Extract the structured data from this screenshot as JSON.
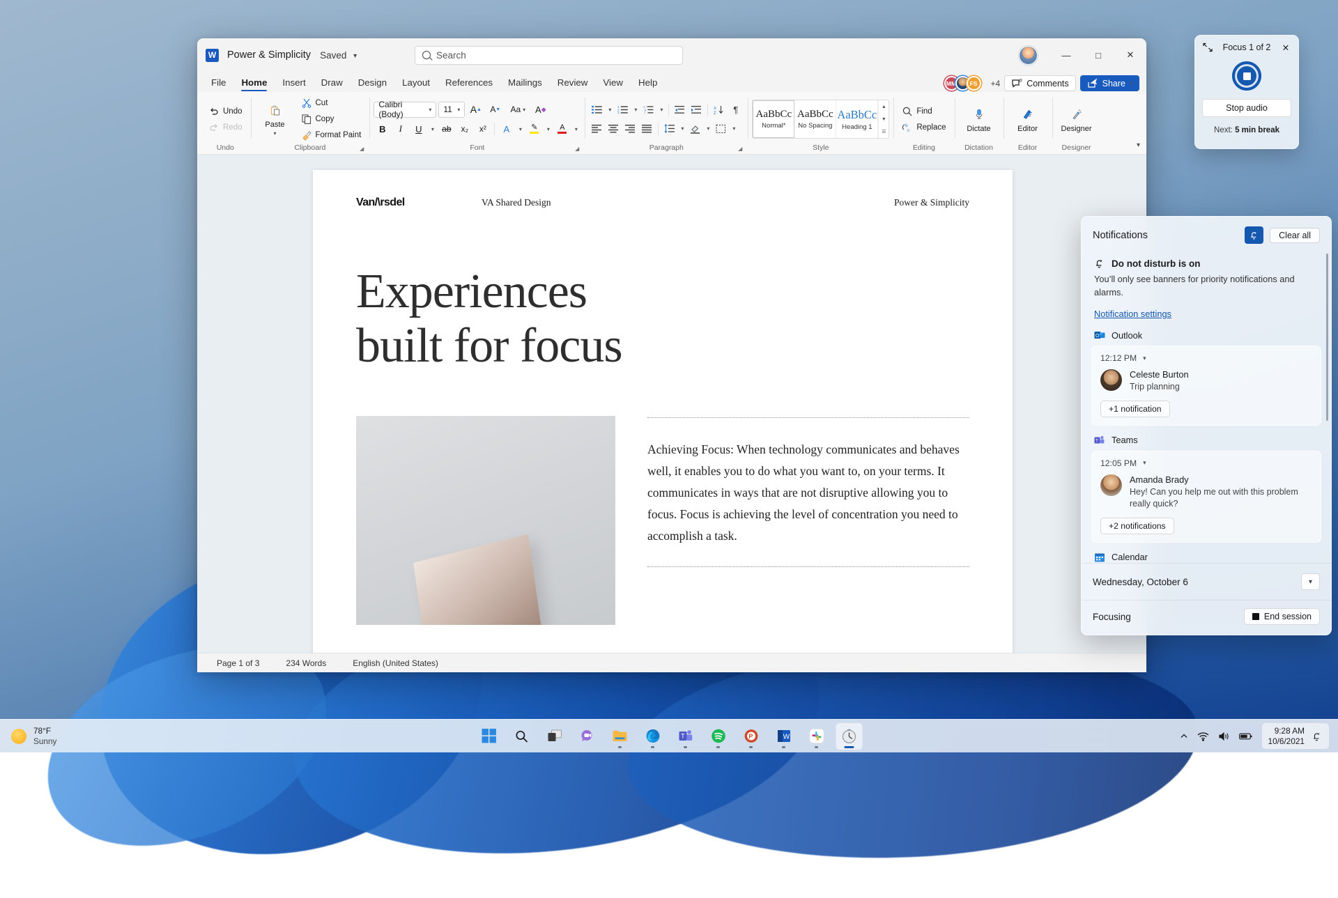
{
  "word": {
    "title": "Power & Simplicity",
    "saved_status": "Saved",
    "search_placeholder": "Search",
    "tabs": [
      {
        "label": "File",
        "active": false
      },
      {
        "label": "Home",
        "active": true
      },
      {
        "label": "Insert",
        "active": false
      },
      {
        "label": "Draw",
        "active": false
      },
      {
        "label": "Design",
        "active": false
      },
      {
        "label": "Layout",
        "active": false
      },
      {
        "label": "References",
        "active": false
      },
      {
        "label": "Mailings",
        "active": false
      },
      {
        "label": "Review",
        "active": false
      },
      {
        "label": "View",
        "active": false
      },
      {
        "label": "Help",
        "active": false
      }
    ],
    "collab": {
      "faces": [
        "MM",
        "",
        "FS"
      ],
      "more": "+4",
      "comments_label": "Comments",
      "share_label": "Share"
    },
    "window_controls": {
      "minimize": "—",
      "maximize": "□",
      "close": "✕"
    },
    "ribbon": {
      "undo": {
        "group_label": "Undo",
        "undo_label": "Undo",
        "redo_label": "Redo"
      },
      "clipboard": {
        "group_label": "Clipboard",
        "paste_label": "Paste",
        "cut_label": "Cut",
        "copy_label": "Copy",
        "format_painter_label": "Format Paint"
      },
      "font": {
        "group_label": "Font",
        "font_name": "Calibri (Body)",
        "font_size": "11",
        "grow_label": "A",
        "shrink_label": "A",
        "change_case_label": "Aa",
        "clear_format_label": "A",
        "bold": "B",
        "italic": "I",
        "underline": "U",
        "strikethrough": "ab",
        "subscript": "x₂",
        "superscript": "x²",
        "text_effects": "A",
        "highlight": "A",
        "font_color": "A"
      },
      "paragraph": {
        "group_label": "Paragraph"
      },
      "style": {
        "group_label": "Style",
        "items": [
          {
            "preview": "AaBbCc",
            "name": "Normal*",
            "selected": true
          },
          {
            "preview": "AaBbCc",
            "name": "No Spacing",
            "selected": false
          },
          {
            "preview": "AaBbCc",
            "name": "Heading 1",
            "selected": false,
            "heading": true
          }
        ]
      },
      "editing": {
        "group_label": "Editing",
        "find_label": "Find",
        "replace_label": "Replace"
      },
      "dictation": {
        "group_label": "Dictation",
        "dictate_label": "Dictate"
      },
      "editor": {
        "group_label": "Editor",
        "editor_label": "Editor"
      },
      "designer": {
        "group_label": "Designer",
        "designer_label": "Designer"
      }
    },
    "document": {
      "brand": "Van/\\rsdel",
      "subtitle": "VA Shared Design",
      "right_label": "Power & Simplicity",
      "heading_line1": "Experiences",
      "heading_line2": "built for focus",
      "paragraph": "Achieving Focus: When technology communicates and behaves well, it enables you to do what you want to, on your terms. It communicates in ways that are not disruptive allowing you to focus. Focus is achieving the level of concentration you need to accomplish a task."
    },
    "status_bar": {
      "page": "Page 1 of 3",
      "words": "234 Words",
      "language": "English (United States)"
    }
  },
  "focus_widget": {
    "title": "Focus 1 of 2",
    "close": "✕",
    "stop_button": "Stop audio",
    "next_prefix": "Next:",
    "next_value": "5 min break"
  },
  "notifications": {
    "title": "Notifications",
    "clear_all": "Clear all",
    "dnd": {
      "title": "Do not disturb is on",
      "description": "You’ll only see banners for priority notifications and alarms.",
      "settings_link": "Notification settings"
    },
    "groups": [
      {
        "app": "Outlook",
        "time": "12:12 PM",
        "sender": "Celeste Burton",
        "message": "Trip planning",
        "more": "+1 notification"
      },
      {
        "app": "Teams",
        "time": "12:05 PM",
        "sender": "Amanda Brady",
        "message": "Hey! Can you help me out with this problem really quick?",
        "more": "+2 notifications"
      }
    ],
    "calendar_label": "Calendar",
    "date": "Wednesday, October 6",
    "focus_label": "Focusing",
    "end_session": "End session"
  },
  "taskbar": {
    "weather": {
      "temp": "78°F",
      "condition": "Sunny"
    },
    "icons": [
      {
        "name": "start-icon",
        "active": false,
        "running": false
      },
      {
        "name": "search-icon",
        "active": false,
        "running": false
      },
      {
        "name": "task-view-icon",
        "active": false,
        "running": false
      },
      {
        "name": "chat-icon",
        "active": false,
        "running": false
      },
      {
        "name": "file-explorer-icon",
        "active": false,
        "running": true
      },
      {
        "name": "edge-icon",
        "active": false,
        "running": true
      },
      {
        "name": "teams-icon",
        "active": false,
        "running": true
      },
      {
        "name": "spotify-icon",
        "active": false,
        "running": true
      },
      {
        "name": "powerpoint-icon",
        "active": false,
        "running": true
      },
      {
        "name": "word-icon",
        "active": false,
        "running": true
      },
      {
        "name": "slack-icon",
        "active": false,
        "running": true
      },
      {
        "name": "clock-icon",
        "active": true,
        "running": true
      }
    ],
    "tray": {
      "chevron": "˄",
      "time": "9:28 AM",
      "date": "10/6/2021"
    }
  },
  "colors": {
    "accent": "#185abd",
    "win_accent": "#1558b0",
    "link": "#1356ad"
  }
}
